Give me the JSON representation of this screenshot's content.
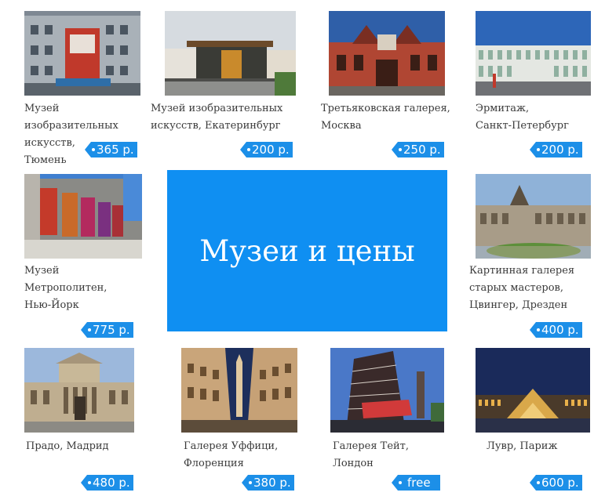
{
  "title": "Музеи и цены",
  "museums": [
    {
      "lines": [
        "Музей",
        "изобразительных",
        "искусств,",
        "Тюмень"
      ],
      "price": "365 р."
    },
    {
      "lines": [
        "Музей изобразительных",
        "искусств, Екатеринбург"
      ],
      "price": "200 р."
    },
    {
      "lines": [
        "Третьяковская галерея,",
        "Москва"
      ],
      "price": "250 р."
    },
    {
      "lines": [
        "Эрмитаж,",
        "Санкт-Петербург"
      ],
      "price": "200 р."
    },
    {
      "lines": [
        "Музей",
        "Метрополитен,",
        "Нью-Йорк"
      ],
      "price": "775 р."
    },
    {
      "lines": [
        "Картинная галерея",
        "старых мастеров,",
        "Цвингер, Дрезден"
      ],
      "price": "400 р."
    },
    {
      "lines": [
        "Прадо, Мадрид"
      ],
      "price": "480 р."
    },
    {
      "lines": [
        "Галерея Уффици,",
        "Флоренция"
      ],
      "price": "380 р."
    },
    {
      "lines": [
        "Галерея Тейт,",
        "Лондон"
      ],
      "price": "free"
    },
    {
      "lines": [
        "Лувр, Париж"
      ],
      "price": "600 р."
    }
  ],
  "colors": {
    "accent": "#0f8ff2",
    "badge": "#1c8fe8"
  }
}
